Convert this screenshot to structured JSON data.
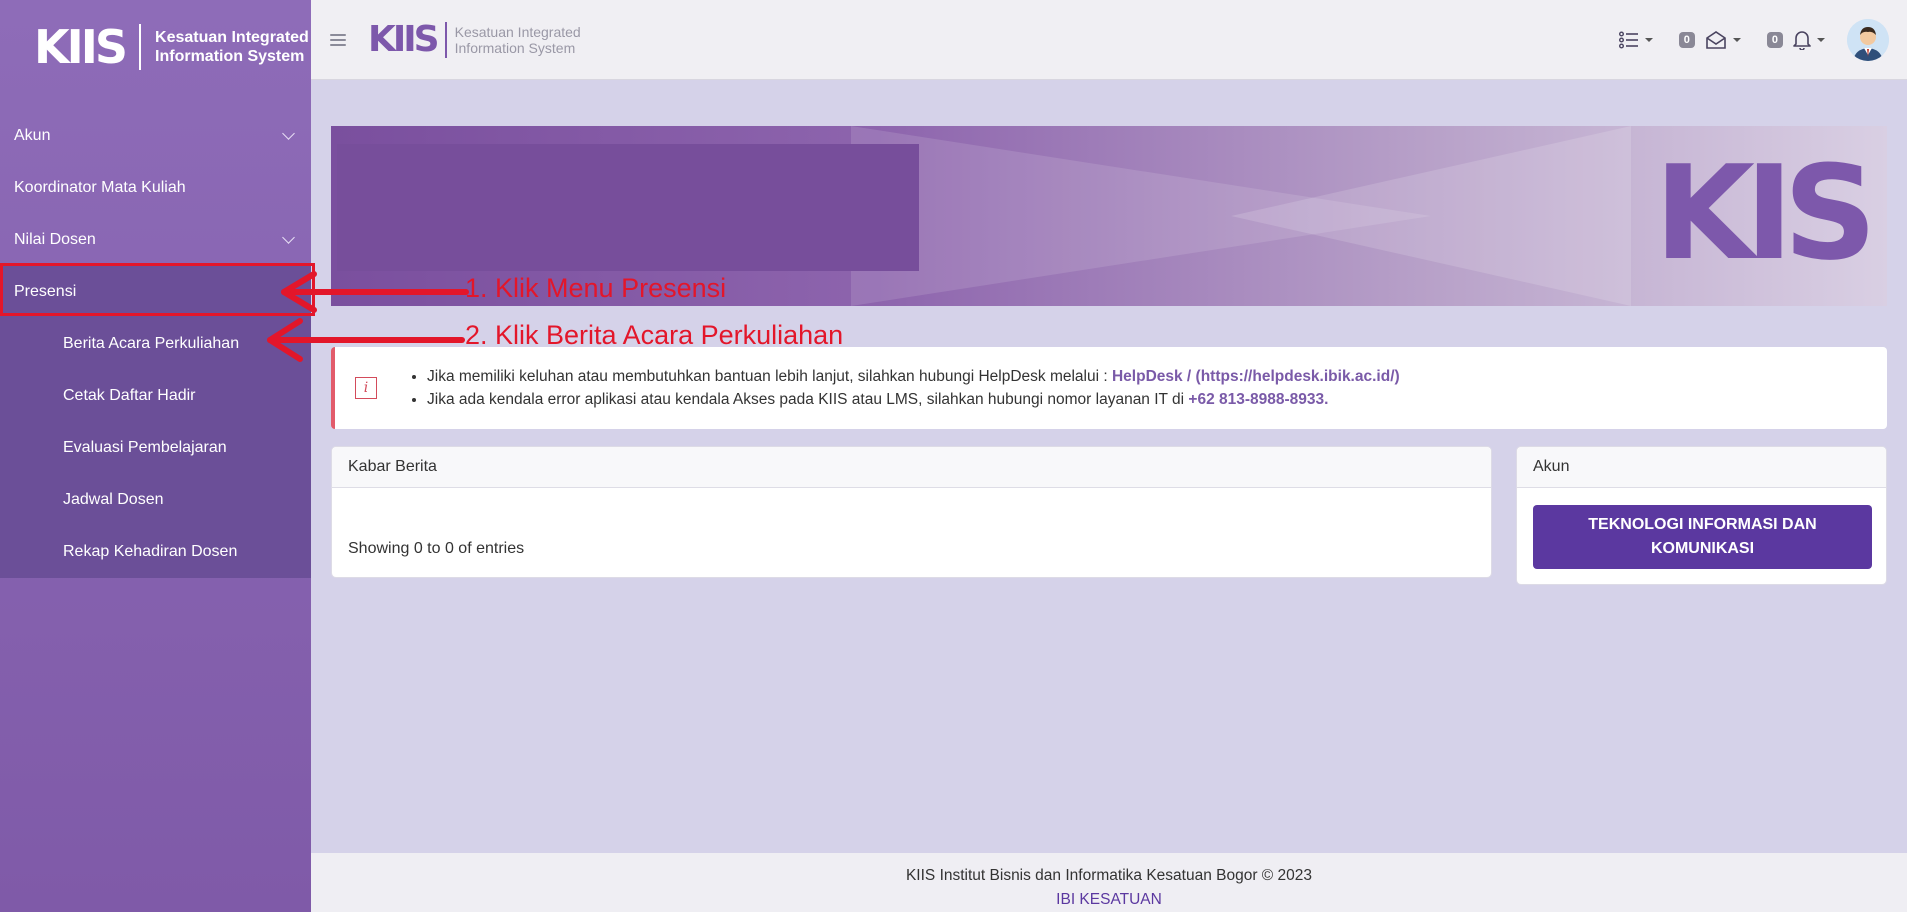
{
  "sidebar": {
    "brand": {
      "logo": "KIIS",
      "line1": "Kesatuan Integrated",
      "line2": "Information System"
    },
    "items": [
      {
        "label": "Akun",
        "expandable": true
      },
      {
        "label": "Koordinator Mata Kuliah",
        "expandable": false
      },
      {
        "label": "Nilai Dosen",
        "expandable": true
      },
      {
        "label": "Presensi",
        "expandable": false,
        "active": true
      }
    ],
    "submenu": [
      {
        "label": "Berita Acara Perkuliahan"
      },
      {
        "label": "Cetak Daftar Hadir"
      },
      {
        "label": "Evaluasi Pembelajaran"
      },
      {
        "label": "Jadwal Dosen"
      },
      {
        "label": "Rekap Kehadiran Dosen"
      }
    ]
  },
  "header": {
    "logo": "KIIS",
    "line1": "Kesatuan Integrated",
    "line2": "Information System",
    "messages_count": "0",
    "notifications_count": "0"
  },
  "banner": {
    "logo": "KIS"
  },
  "alert": {
    "line1_text": "Jika memiliki keluhan atau membutuhkan bantuan lebih lanjut, silahkan hubungi HelpDesk melalui : ",
    "line1_link": "HelpDesk / (https://helpdesk.ibik.ac.id/)",
    "line2_text": "Jika ada kendala error aplikasi atau kendala Akses pada KIIS atau LMS, silahkan hubungi nomor layanan IT di ",
    "line2_phone": "+62 813-8988-8933."
  },
  "news_card": {
    "title": "Kabar Berita",
    "entries_info": "Showing 0 to 0 of entries"
  },
  "akun_card": {
    "title": "Akun",
    "button_label": "TEKNOLOGI INFORMASI DAN KOMUNIKASI"
  },
  "footer": {
    "copyright": "KIIS Institut Bisnis dan Informatika Kesatuan Bogor © 2023",
    "org": "IBI KESATUAN"
  },
  "annotations": {
    "step1": "1. Klik Menu Presensi",
    "step2": "2. Klik Berita Acara Perkuliahan",
    "color": "#e3162a"
  },
  "colors": {
    "sidebar": "#8e6cb8",
    "accent": "#5b38a0",
    "alert_border": "#e25b6b"
  }
}
